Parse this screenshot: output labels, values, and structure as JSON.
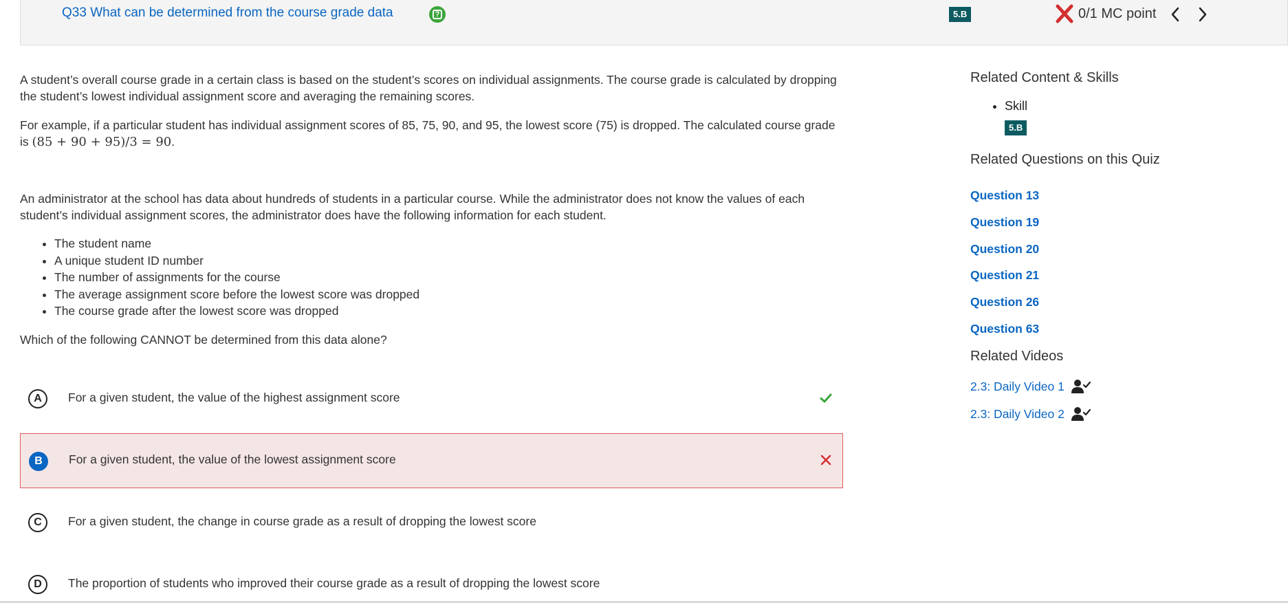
{
  "header": {
    "question_title": "Q33 What can be determined from the course grade data",
    "skill_badge": "5.B",
    "score": "0/1 MC point"
  },
  "question": {
    "paragraph1": "A student’s overall course grade in a certain class is based on the student’s scores on individual assignments. The course grade is calculated by dropping the student’s lowest individual assignment score and averaging the remaining scores.",
    "paragraph2_prefix": "For example, if a particular student has individual assignment scores of 85, 75, 90, and 95, the lowest score (75) is dropped. The calculated course grade is ",
    "paragraph2_math": "(85 + 90 + 95)/3 = 90",
    "paragraph2_suffix": ".",
    "paragraph3": "An administrator at the school has data about hundreds of students in a particular course. While the administrator does not know the values of each student’s individual assignment scores, the administrator does have the following information for each student.",
    "bullets": [
      "The student name",
      "A unique student ID number",
      "The number of assignments for the course",
      "The average assignment score before the lowest score was dropped",
      "The course grade after the lowest score was dropped"
    ],
    "prompt": "Which of the following CANNOT be determined from this data alone?"
  },
  "choices": [
    {
      "letter": "A",
      "text": "For a given student, the value of the highest assignment score",
      "status": "correct"
    },
    {
      "letter": "B",
      "text": "For a given student, the value of the lowest assignment score",
      "status": "incorrect-selected"
    },
    {
      "letter": "C",
      "text": "For a given student, the change in course grade as a result of dropping the lowest score",
      "status": "none"
    },
    {
      "letter": "D",
      "text": "The proportion of students who improved their course grade as a result of dropping the lowest score",
      "status": "none"
    }
  ],
  "sidebar": {
    "related_content_heading": "Related Content & Skills",
    "skill_label": "Skill",
    "skill_badge": "5.B",
    "related_questions_heading": "Related Questions on this Quiz",
    "related_questions": [
      "Question 13",
      "Question 19",
      "Question 20",
      "Question 21",
      "Question 26",
      "Question 63"
    ],
    "related_videos_heading": "Related Videos",
    "videos": [
      "2.3: Daily Video 1",
      "2.3: Daily Video 2"
    ]
  },
  "colors": {
    "link": "#0a66c2",
    "badge": "#0d5b61",
    "incorrect": "#d32f2f",
    "correct": "#3aa53a",
    "incorrect_bg": "#f5e6e6"
  },
  "icons": [
    "help-icon",
    "incorrect-x-icon",
    "chevron-left-icon",
    "chevron-right-icon",
    "checkmark-icon",
    "close-x-icon",
    "person-check-icon"
  ]
}
